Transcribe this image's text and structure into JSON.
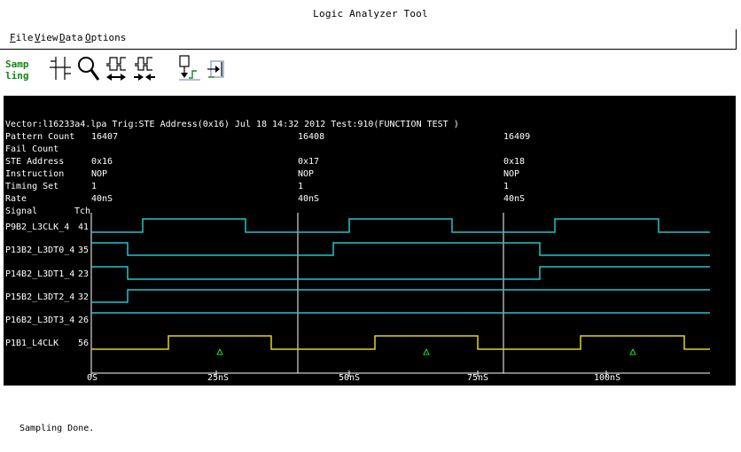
{
  "window": {
    "title": "Logic Analyzer Tool"
  },
  "menu": [
    {
      "label": "File",
      "key": "F"
    },
    {
      "label": "View",
      "key": "V"
    },
    {
      "label": "Data",
      "key": "D"
    },
    {
      "label": "Options",
      "key": "O"
    }
  ],
  "toolbar": {
    "sampling_label_1": "Samp",
    "sampling_label_2": "ling",
    "icons": [
      "cursor-cross-icon",
      "zoom-magnifier-icon",
      "shift-waveform-left-icon",
      "shift-waveform-right-icon",
      "trigger-step-icon",
      "goto-marker-icon"
    ]
  },
  "header": {
    "vector_line": "Vector:l16233a4.lpa Trig:STE Address(0x16) Jul 18 14:32 2012 Test:910(FUNCTION TEST )",
    "rows": [
      {
        "label": "Pattern Count",
        "values": [
          "16407",
          "16408",
          "16409"
        ]
      },
      {
        "label": "Fail Count",
        "values": [
          "",
          "",
          ""
        ]
      },
      {
        "label": "STE Address",
        "values": [
          "0x16",
          "0x17",
          "0x18"
        ]
      },
      {
        "label": "Instruction",
        "values": [
          "NOP",
          "NOP",
          "NOP"
        ]
      },
      {
        "label": "Timing Set",
        "values": [
          "1",
          "1",
          "1"
        ]
      },
      {
        "label": "Rate",
        "values": [
          "40nS",
          "40nS",
          "40nS"
        ]
      }
    ],
    "signal_header": "Signal",
    "tch_header": "Tch"
  },
  "signals": [
    {
      "name": "P9B2_L3CLK_4",
      "tch": "41",
      "color": "#22c4cc"
    },
    {
      "name": "P13B2_L3DT0_4",
      "tch": "35",
      "color": "#22c4cc"
    },
    {
      "name": "P14B2_L3DT1_4",
      "tch": "23",
      "color": "#22c4cc"
    },
    {
      "name": "P15B2_L3DT2_4",
      "tch": "32",
      "color": "#22c4cc"
    },
    {
      "name": "P16B2_L3DT3_4",
      "tch": "26",
      "color": "#22c4cc"
    },
    {
      "name": "P1B1_L4CLK",
      "tch": "56",
      "color": "#e6d21a"
    }
  ],
  "time_axis": {
    "ticks": [
      "0S",
      "25nS",
      "50nS",
      "75nS",
      "100nS"
    ]
  },
  "status": "Sampling Done."
}
